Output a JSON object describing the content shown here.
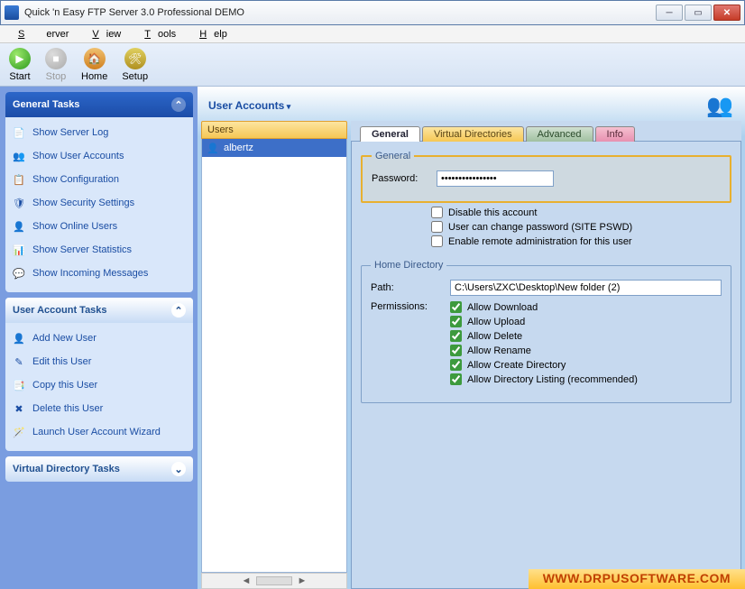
{
  "window": {
    "title": "Quick 'n Easy FTP Server 3.0 Professional DEMO"
  },
  "menu": {
    "server": "Server",
    "view": "View",
    "tools": "Tools",
    "help": "Help"
  },
  "toolbar": {
    "start": "Start",
    "stop": "Stop",
    "home": "Home",
    "setup": "Setup"
  },
  "sidebar": {
    "general": {
      "title": "General Tasks",
      "items": [
        "Show Server Log",
        "Show User Accounts",
        "Show Configuration",
        "Show Security Settings",
        "Show Online Users",
        "Show Server Statistics",
        "Show Incoming Messages"
      ]
    },
    "user": {
      "title": "User Account Tasks",
      "items": [
        "Add New User",
        "Edit this User",
        "Copy this User",
        "Delete this User",
        "Launch User Account Wizard"
      ]
    },
    "vdir": {
      "title": "Virtual Directory Tasks"
    }
  },
  "content": {
    "title": "User Accounts",
    "users_header": "Users",
    "users": [
      "albertz"
    ],
    "tabs": {
      "general": "General",
      "vd": "Virtual Directories",
      "adv": "Advanced",
      "info": "Info"
    },
    "general_group": {
      "legend": "General",
      "password_label": "Password:",
      "password_value": "••••••••••••••••",
      "disable": "Disable this account",
      "can_change": "User can change password (SITE PSWD)",
      "remote_admin": "Enable remote administration for this user"
    },
    "home_group": {
      "legend": "Home Directory",
      "path_label": "Path:",
      "path_value": "C:\\Users\\ZXC\\Desktop\\New folder (2)",
      "perm_label": "Permissions:",
      "perms": [
        "Allow Download",
        "Allow Upload",
        "Allow Delete",
        "Allow Rename",
        "Allow Create Directory",
        "Allow Directory Listing (recommended)"
      ]
    }
  },
  "footer": {
    "url": "WWW.DRPUSOFTWARE.COM"
  }
}
